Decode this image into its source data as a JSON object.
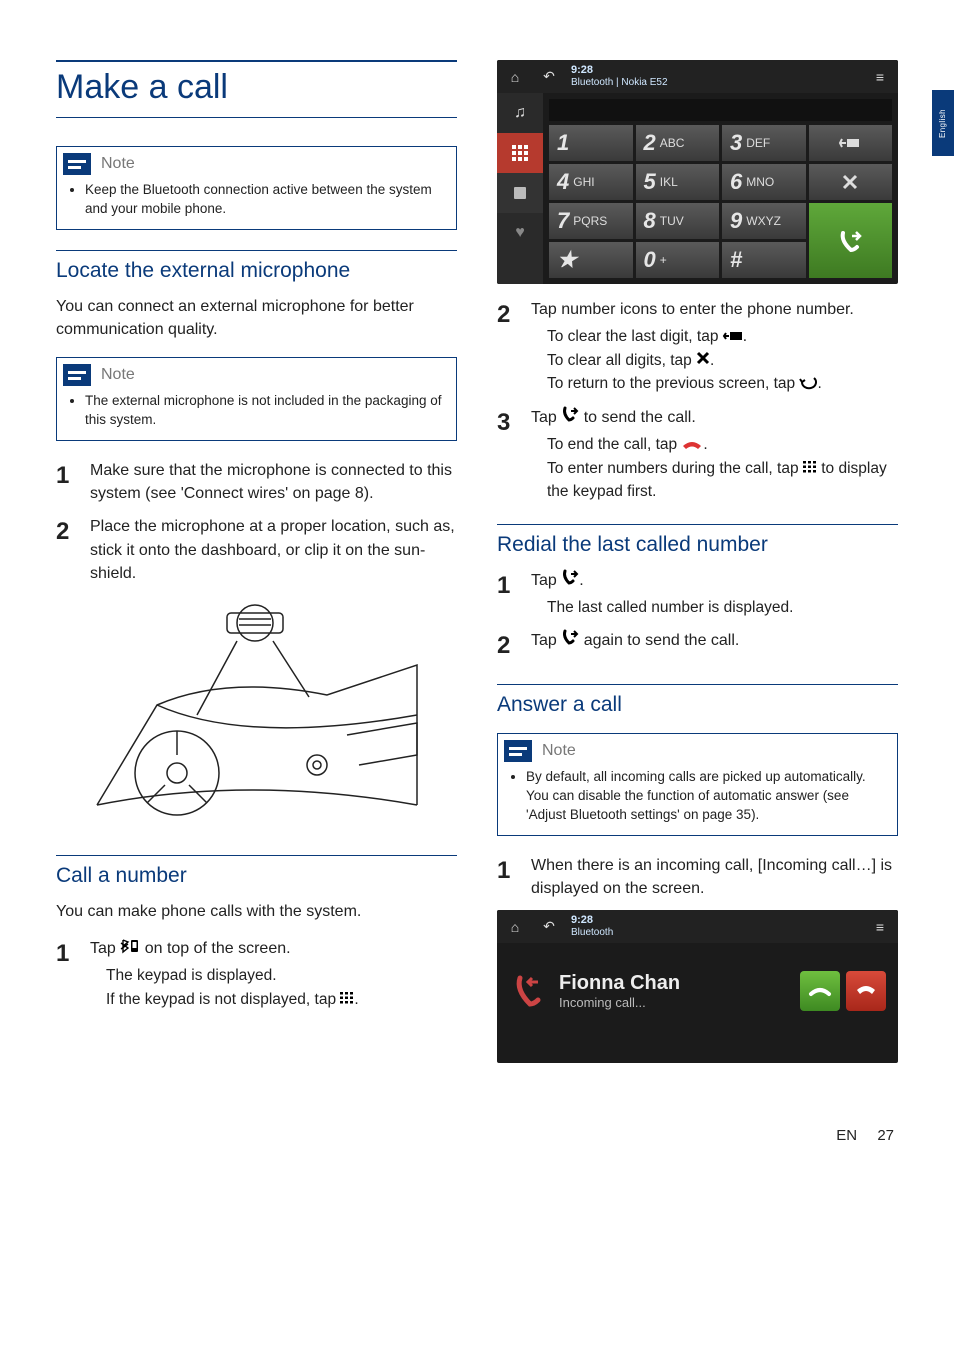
{
  "sideTab": "English",
  "h1": "Make a call",
  "note1": {
    "label": "Note",
    "text": "Keep the Bluetooth connection active between the system and your mobile phone."
  },
  "h2_locate": "Locate the external microphone",
  "locate_intro": "You can connect an external microphone for better communication quality.",
  "note2": {
    "label": "Note",
    "text": "The external microphone is not included in the packaging of this system."
  },
  "locate_steps": [
    "Make sure that the microphone is connected to this system (see 'Connect wires' on page 8).",
    "Place the microphone at a proper location, such as, stick it onto the dashboard, or clip it on the sun-shield."
  ],
  "h2_call": "Call a number",
  "call_intro": "You can make phone calls with the system.",
  "call_step1_a": "Tap ",
  "call_step1_b": " on top of the screen.",
  "call_step1_sub1": "The keypad is displayed.",
  "call_step1_sub2_a": "If the keypad is not displayed, tap ",
  "call_step1_sub2_b": ".",
  "device1": {
    "time": "9:28",
    "status": "Bluetooth | Nokia E52",
    "keys": [
      {
        "n": "1",
        "l": ""
      },
      {
        "n": "2",
        "l": "ABC"
      },
      {
        "n": "3",
        "l": "DEF"
      },
      {
        "n": "4",
        "l": "GHI"
      },
      {
        "n": "5",
        "l": "IKL"
      },
      {
        "n": "6",
        "l": "MNO"
      },
      {
        "n": "7",
        "l": "PQRS"
      },
      {
        "n": "8",
        "l": "TUV"
      },
      {
        "n": "9",
        "l": "WXYZ"
      },
      {
        "n": "★",
        "l": ""
      },
      {
        "n": "0",
        "l": "+"
      },
      {
        "n": "#",
        "l": ""
      }
    ]
  },
  "r_step2": "Tap number icons to enter the phone number.",
  "r_step2_sub1_a": "To clear the last digit, tap ",
  "r_step2_sub1_b": ".",
  "r_step2_sub2_a": "To clear all digits, tap ",
  "r_step2_sub2_b": ".",
  "r_step2_sub3_a": "To return to the previous screen, tap ",
  "r_step2_sub3_b": ".",
  "r_step3_a": "Tap ",
  "r_step3_b": " to send the call.",
  "r_step3_sub1_a": "To end the call, tap ",
  "r_step3_sub1_b": ".",
  "r_step3_sub2_a": "To enter numbers during the call, tap ",
  "r_step3_sub2_b": " to display the keypad first.",
  "h2_redial": "Redial the last called number",
  "redial_step1_a": "Tap ",
  "redial_step1_b": ".",
  "redial_sub1": "The last called number is displayed.",
  "redial_step2_a": "Tap ",
  "redial_step2_b": " again to send the call.",
  "h2_answer": "Answer a call",
  "note3": {
    "label": "Note",
    "text": "By default, all incoming calls are picked up automatically. You can disable the function of automatic answer (see 'Adjust Bluetooth settings' on page 35)."
  },
  "answer_step1_a": "When there is an incoming call, ",
  "answer_step1_bold": "[Incoming call…]",
  "answer_step1_b": " is displayed on the screen.",
  "device2": {
    "time": "9:28",
    "status": "Bluetooth",
    "name": "Fionna Chan",
    "sub": "Incoming call..."
  },
  "footer": {
    "lang": "EN",
    "page": "27"
  }
}
